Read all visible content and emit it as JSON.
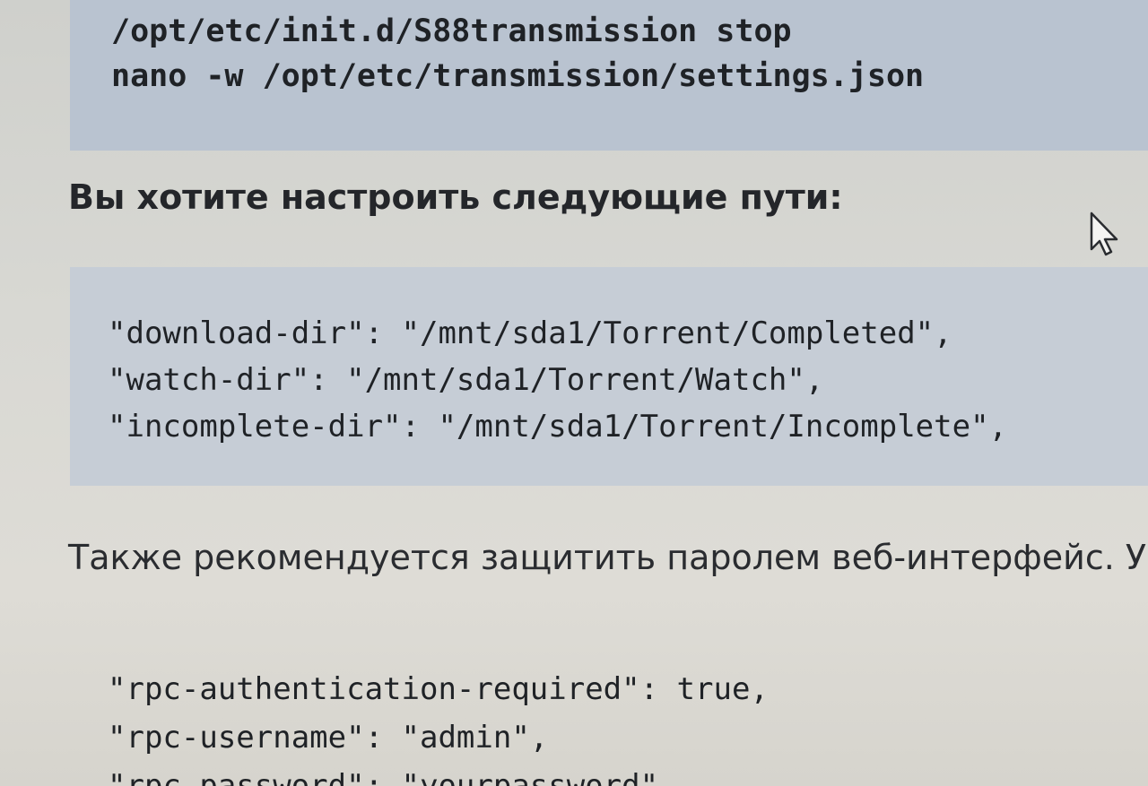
{
  "code_top": {
    "lines": [
      "/opt/etc/init.d/S88transmission stop",
      "nano -w /opt/etc/transmission/settings.json"
    ]
  },
  "paragraph_paths": "Вы хотите настроить следующие пути:",
  "code_paths": {
    "lines": [
      "\"download-dir\": \"/mnt/sda1/Torrent/Completed\",",
      "\"watch-dir\": \"/mnt/sda1/Torrent/Watch\",",
      "\"incomplete-dir\": \"/mnt/sda1/Torrent/Incomplete\","
    ]
  },
  "paragraph_password": "Также рекомендуется защитить паролем веб-интерфейс. Уста",
  "code_rpc": {
    "lines": [
      "\"rpc-authentication-required\": true,",
      "\"rpc-username\": \"admin\",",
      "\"rpc-password\": \"yourpassword\","
    ]
  },
  "icons": {
    "cursor": "mouse-pointer-icon"
  },
  "colors": {
    "code_background": "#bcc6d3",
    "page_background": "#d8d8d3",
    "text": "#222428"
  }
}
